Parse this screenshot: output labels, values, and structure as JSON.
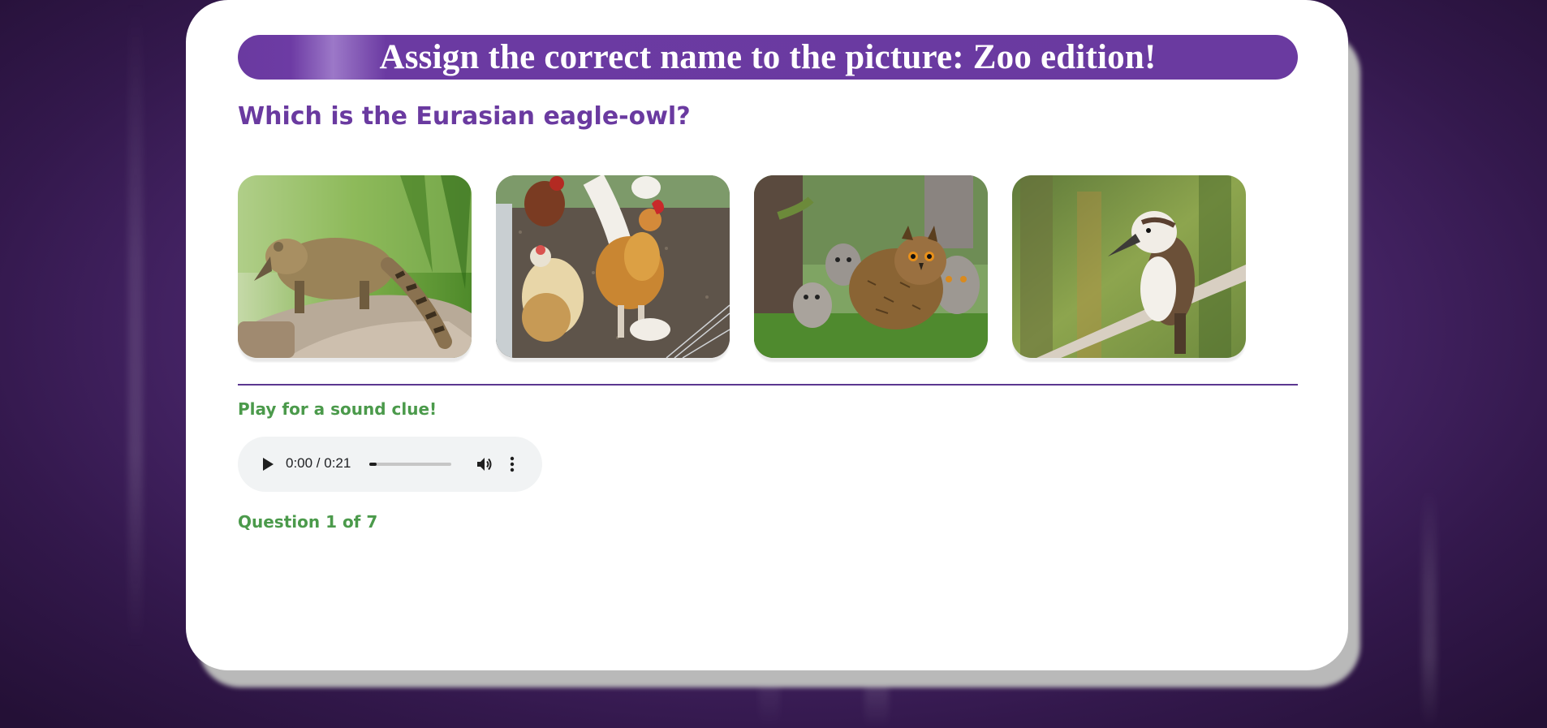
{
  "quiz": {
    "title": "Assign the correct name to the picture: Zoo edition!",
    "question": "Which is the Eurasian eagle-owl?",
    "choices": [
      {
        "image": "coati-photo"
      },
      {
        "image": "chickens-photo"
      },
      {
        "image": "eagle-owl-with-chicks-photo"
      },
      {
        "image": "kookaburra-photo"
      }
    ],
    "sound_clue_label": "Play for a sound clue!",
    "audio": {
      "current_time": "0:00",
      "duration": "0:21",
      "time_display": "0:00 / 0:21",
      "progress": 0.0,
      "play_icon": "play-icon",
      "volume_icon": "volume-icon",
      "menu_icon": "more-vert-icon"
    },
    "progress_text": "Question 1 of 7"
  },
  "colors": {
    "accent_purple": "#6a3aa0",
    "green_text": "#4b9a4b",
    "background": "#4f2a73"
  }
}
